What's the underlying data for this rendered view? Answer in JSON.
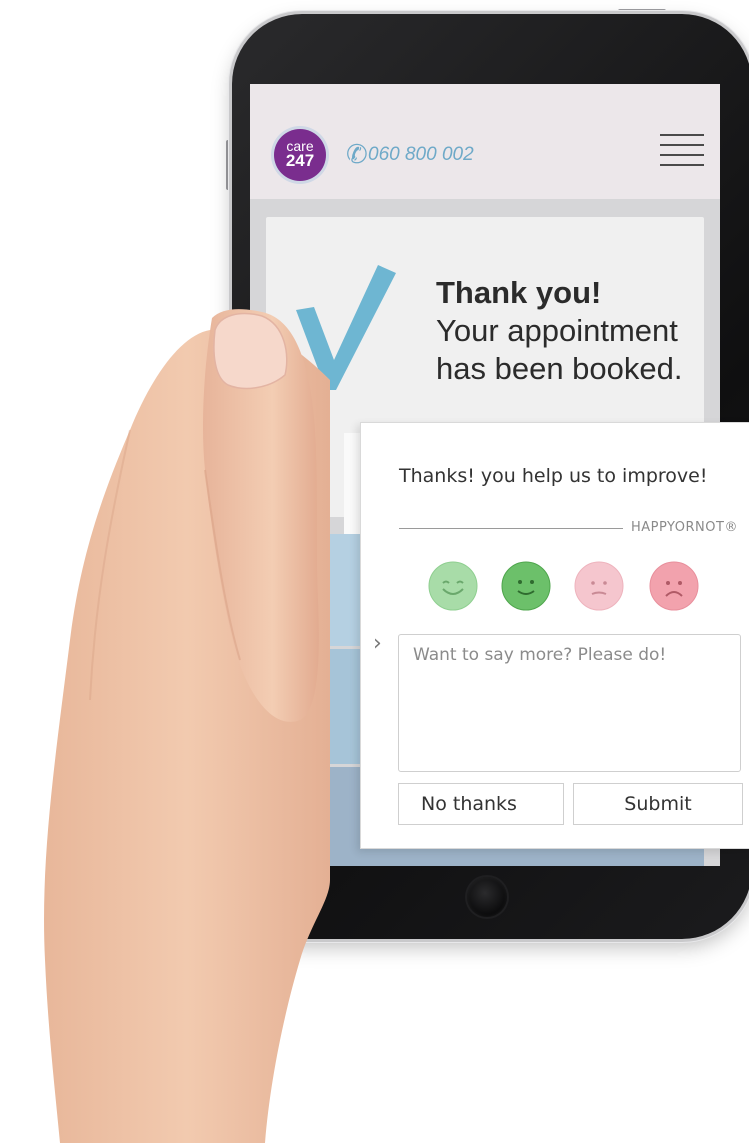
{
  "app": {
    "logo_line1": "care",
    "logo_line2": "247",
    "phone_number": "060 800 002"
  },
  "confirmation": {
    "title": "Thank you!",
    "line1": "Your appointment",
    "line2": "has been booked."
  },
  "feedback": {
    "title": "Thanks! you help us to improve!",
    "brand": "HAPPYORNOT®",
    "textarea_placeholder": "Want to say more? Please do!",
    "no_thanks_label": "No thanks",
    "submit_label": "Submit",
    "smileys": [
      {
        "name": "very-happy",
        "color": "#a8dca8"
      },
      {
        "name": "happy",
        "color": "#6cc06a"
      },
      {
        "name": "unhappy",
        "color": "#f5c6ce"
      },
      {
        "name": "very-unhappy",
        "color": "#f2a2ad"
      }
    ]
  },
  "colors": {
    "brand_purple": "#7a2d8e",
    "accent_blue": "#6ea9c8"
  }
}
